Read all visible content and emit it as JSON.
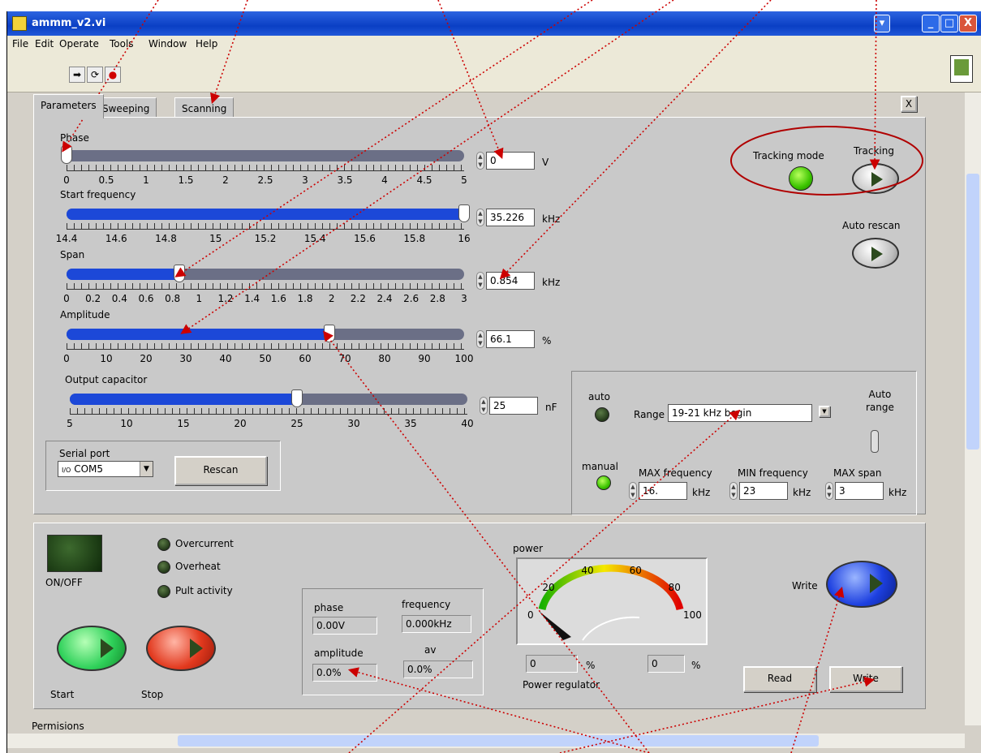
{
  "window": {
    "title": "ammm_v2.vi",
    "minimize": "_",
    "maximize": "□",
    "close": "X"
  },
  "menu": [
    "File",
    "Edit",
    "Operate",
    "Tools",
    "Window",
    "Help"
  ],
  "toolbar": {
    "run": "➡",
    "run_cont": "⟳",
    "stop": "●"
  },
  "tabs": [
    "Parameters",
    "Sweeping",
    "Scanning"
  ],
  "tab_close": "X",
  "sliders": {
    "phase": {
      "label": "Phase",
      "min": 0,
      "max": 5,
      "value": 0,
      "ticks": [
        "0",
        "0.5",
        "1",
        "1.5",
        "2",
        "2.5",
        "3",
        "3.5",
        "4",
        "4.5",
        "5"
      ],
      "display": "0",
      "unit": "V"
    },
    "start_frequency": {
      "label": "Start frequency",
      "min": 14.4,
      "max": 16,
      "value": 16,
      "ticks": [
        "14.4",
        "14.6",
        "14.8",
        "15",
        "15.2",
        "15.4",
        "15.6",
        "15.8",
        "16"
      ],
      "display": "35.226",
      "unit": "kHz"
    },
    "span": {
      "label": "Span",
      "min": 0,
      "max": 3,
      "value": 0.854,
      "ticks": [
        "0",
        "0.2",
        "0.4",
        "0.6",
        "0.8",
        "1",
        "1.2",
        "1.4",
        "1.6",
        "1.8",
        "2",
        "2.2",
        "2.4",
        "2.6",
        "2.8",
        "3"
      ],
      "display": "0.854",
      "unit": "kHz"
    },
    "amplitude": {
      "label": "Amplitude",
      "min": 0,
      "max": 100,
      "value": 66.1,
      "ticks": [
        "0",
        "10",
        "20",
        "30",
        "40",
        "50",
        "60",
        "70",
        "80",
        "90",
        "100"
      ],
      "display": "66.1",
      "unit": "%"
    },
    "output_capacitor": {
      "label": "Output capacitor",
      "min": 5,
      "max": 40,
      "value": 25,
      "ticks": [
        "5",
        "10",
        "15",
        "20",
        "25",
        "30",
        "35",
        "40"
      ],
      "display": "25",
      "unit": "nF"
    }
  },
  "tracking": {
    "mode_label": "Tracking mode",
    "button_label": "Tracking",
    "mode_on": true
  },
  "auto_rescan": {
    "label": "Auto rescan"
  },
  "range_box": {
    "auto_label": "auto",
    "manual_label": "manual",
    "range_label": "Range",
    "range_value": "19-21 kHz begin",
    "auto_range_label": "Auto\nrange",
    "max_freq_label": "MAX frequency",
    "max_freq_value": "16.",
    "min_freq_label": "MIN frequency",
    "min_freq_value": "23",
    "max_span_label": "MAX span",
    "max_span_value": "3",
    "unit": "kHz"
  },
  "serial": {
    "label": "Serial port",
    "value": "COM5",
    "prefix": "I/O",
    "rescan": "Rescan"
  },
  "status": {
    "on_off": "ON/OFF",
    "overcurrent": "Overcurrent",
    "overheat": "Overheat",
    "pult": "Pult activity",
    "start": "Start",
    "stop": "Stop"
  },
  "readouts": {
    "phase_label": "phase",
    "phase_value": "0.00V",
    "frequency_label": "frequency",
    "frequency_value": "0.000kHz",
    "amplitude_label": "amplitude",
    "amplitude_value": "0.0%",
    "av_label": "av",
    "av_value": "0.0%"
  },
  "power": {
    "label": "power",
    "ticks": [
      "0",
      "20",
      "40",
      "60",
      "80",
      "100"
    ],
    "value": 0,
    "regulator_label": "Power regulator",
    "reg_value1": "0",
    "reg_value2": "0",
    "unit": "%"
  },
  "write": {
    "label": "Write",
    "read_button": "Read",
    "write_button": "Write"
  },
  "footer": {
    "permissions": "Permisions"
  },
  "colors": {
    "accent": "#1c48d8",
    "annotation": "#cc0000",
    "led_on": "#3bc400"
  }
}
